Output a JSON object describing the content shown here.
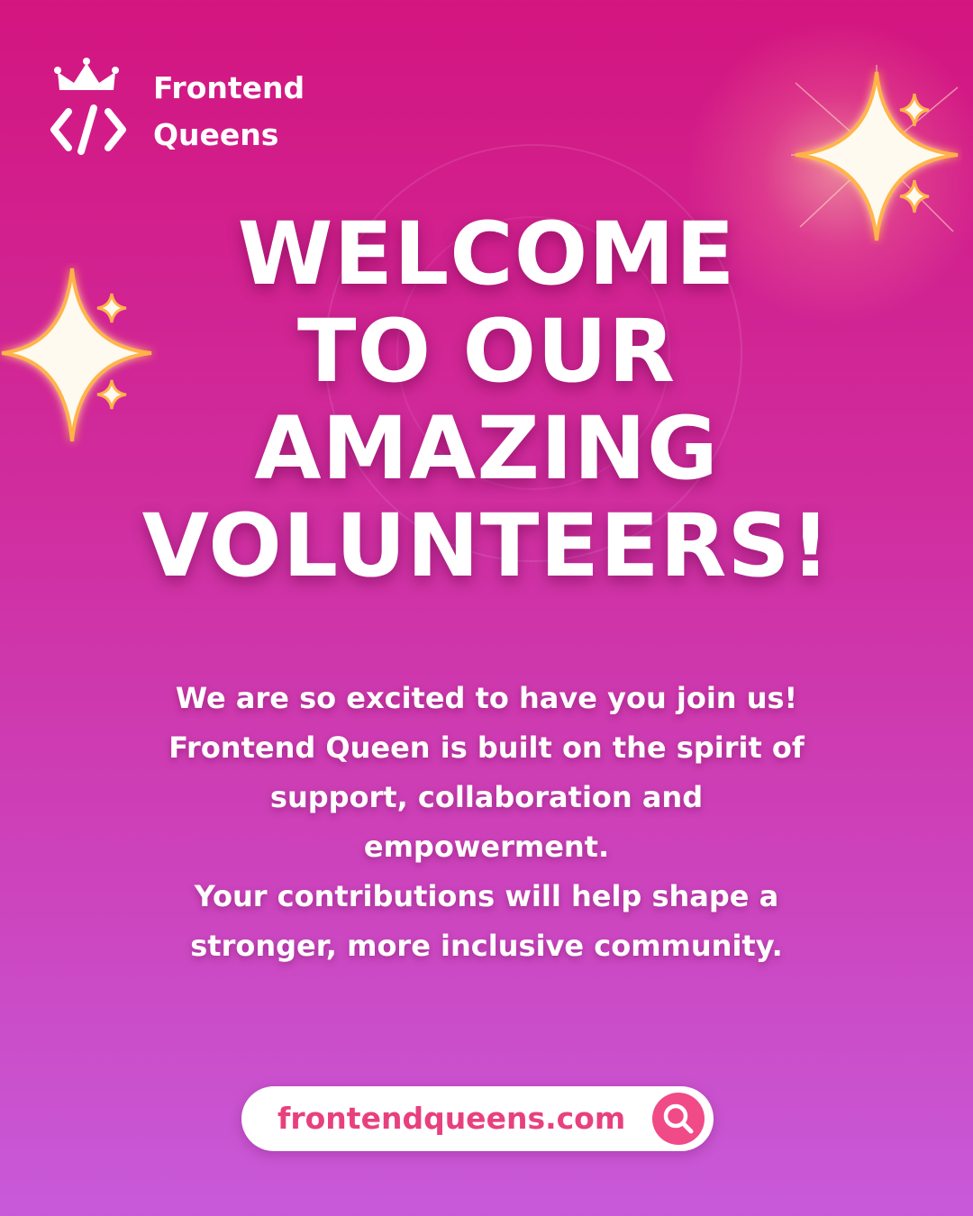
{
  "brand": {
    "name_line1": "Frontend",
    "name_line2": "Queens",
    "logo_icon": "crown-code-icon"
  },
  "headline": {
    "line1": "WELCOME",
    "line2": "TO OUR",
    "line3": "AMAZING",
    "line4": "VOLUNTEERS!"
  },
  "body": {
    "lines": [
      "We are so excited to have you join us!",
      "Frontend Queen is built on the spirit of",
      "support, collaboration and",
      "empowerment.",
      "Your contributions will help shape a",
      "stronger, more inclusive community."
    ]
  },
  "footer": {
    "url": "frontendqueens.com",
    "search_icon": "search-icon"
  },
  "colors": {
    "background_top": "#d3157f",
    "background_bottom": "#c85ad9",
    "accent": "#f04a87",
    "text": "#ffffff",
    "sparkle_glow": "#ffb44a"
  }
}
